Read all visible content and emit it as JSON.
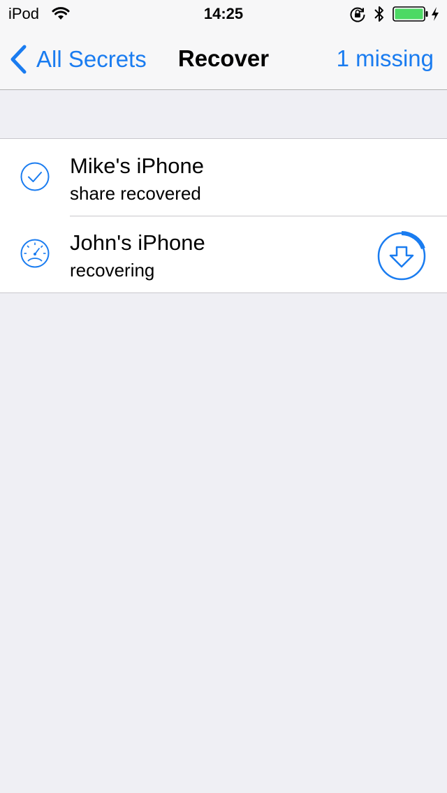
{
  "status_bar": {
    "carrier": "iPod",
    "time": "14:25"
  },
  "nav": {
    "back_label": "All Secrets",
    "title": "Recover",
    "right_label": "1 missing"
  },
  "devices": [
    {
      "name": "Mike's iPhone",
      "status": "share recovered",
      "icon": "checkmark-circle-icon"
    },
    {
      "name": "John's iPhone",
      "status": "recovering",
      "icon": "speedometer-icon",
      "action_icon": "download-progress-icon"
    }
  ],
  "colors": {
    "accent": "#1a7cf0",
    "background": "#efeff4",
    "battery": "#4cd964"
  }
}
